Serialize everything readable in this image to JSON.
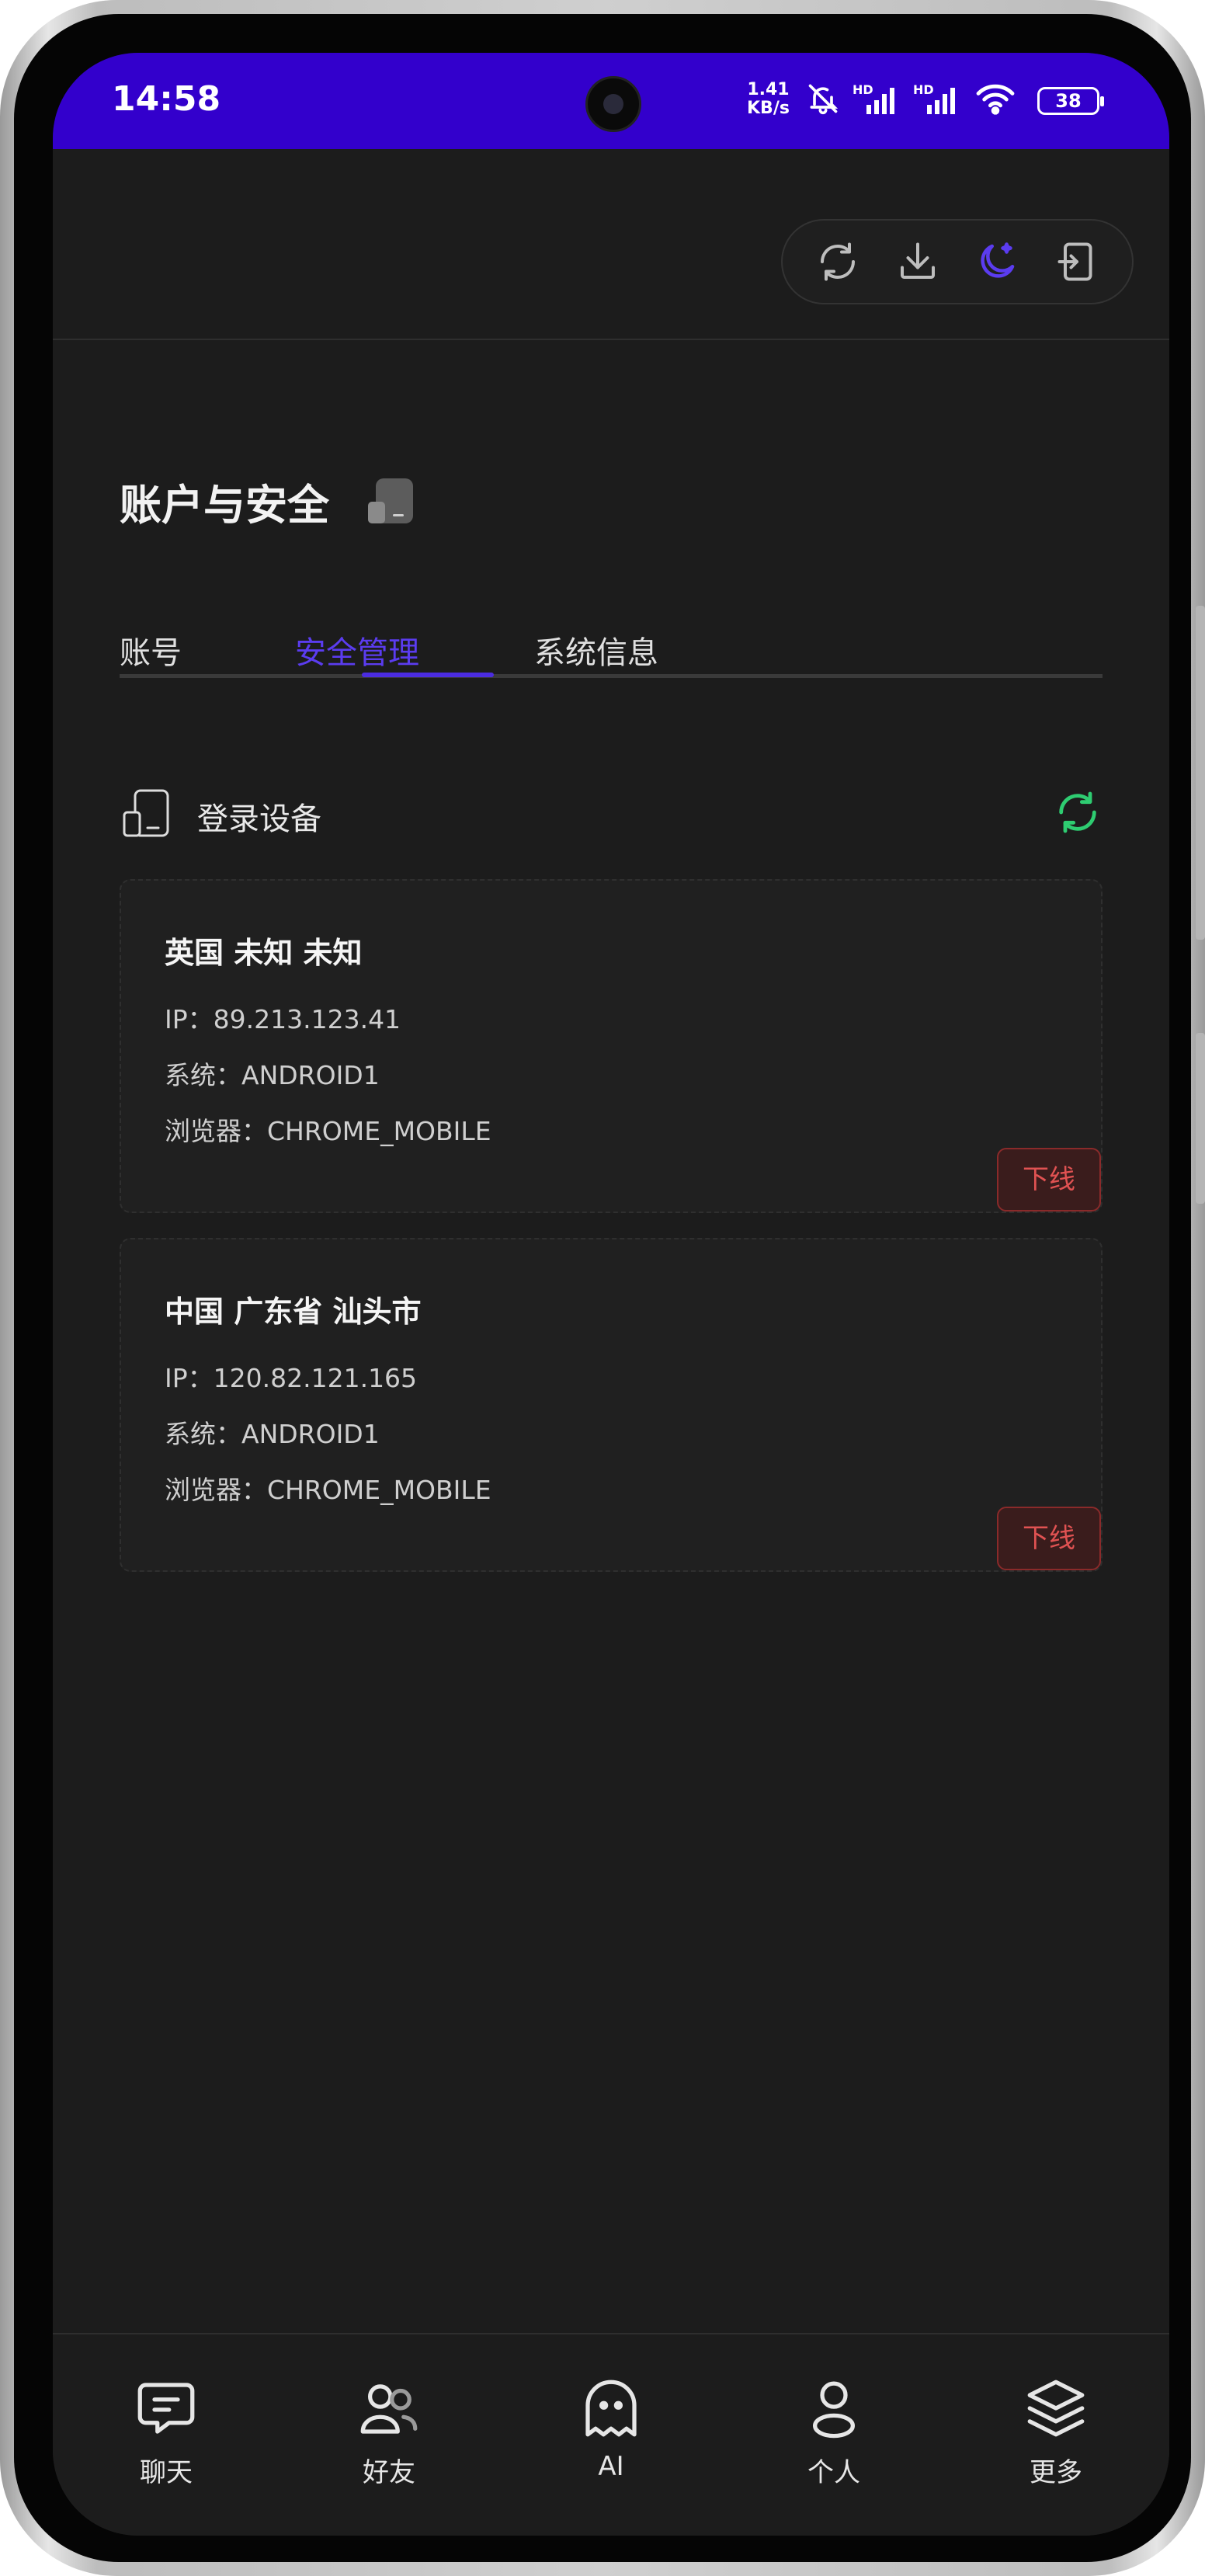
{
  "status_bar": {
    "time": "14:58",
    "speed_value": "1.41",
    "speed_unit": "KB/s",
    "battery": "38",
    "icons": [
      "bell-off-icon",
      "signal-hd-icon",
      "signal-hd-icon",
      "wifi-icon"
    ]
  },
  "toolbar": {
    "icons": [
      "refresh-icon",
      "download-icon",
      "moon-icon",
      "logout-icon"
    ],
    "active_color": "#5b3cf0"
  },
  "page": {
    "title": "账户与安全"
  },
  "tabs": [
    {
      "label": "账号",
      "active": false
    },
    {
      "label": "安全管理",
      "active": true
    },
    {
      "label": "系统信息",
      "active": false
    }
  ],
  "section": {
    "label": "登录设备",
    "refresh_color": "#2ecc71"
  },
  "devices": [
    {
      "location": "英国 未知 未知",
      "ip": "IP：89.213.123.41",
      "system": "系统：ANDROID1",
      "browser": "浏览器：CHROME_MOBILE",
      "action": "下线"
    },
    {
      "location": "中国 广东省 汕头市",
      "ip": "IP：120.82.121.165",
      "system": "系统：ANDROID1",
      "browser": "浏览器：CHROME_MOBILE",
      "action": "下线"
    }
  ],
  "bottom_nav": [
    {
      "label": "聊天",
      "icon": "chat-icon"
    },
    {
      "label": "好友",
      "icon": "friends-icon"
    },
    {
      "label": "AI",
      "icon": "ghost-icon"
    },
    {
      "label": "个人",
      "icon": "person-icon"
    },
    {
      "label": "更多",
      "icon": "layers-icon"
    }
  ],
  "colors": {
    "statusbar": "#3300cc",
    "background": "#1c1c1c",
    "danger": "#e05252"
  }
}
